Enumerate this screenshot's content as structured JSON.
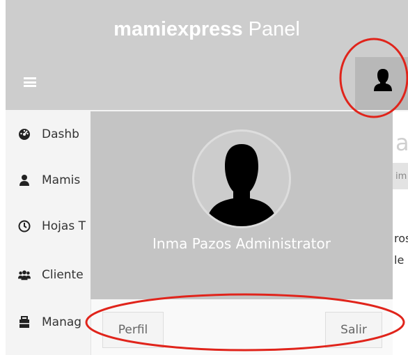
{
  "header": {
    "brand_bold": "mamiexpress",
    "brand_light": " Panel",
    "menu_icon": "hamburger-icon",
    "user_icon": "user-icon"
  },
  "sidebar": {
    "items": [
      {
        "label": "Dashb",
        "icon": "dashboard-icon"
      },
      {
        "label": "Mamis",
        "icon": "user-icon"
      },
      {
        "label": "Hojas T",
        "icon": "clock-icon"
      },
      {
        "label": "Cliente",
        "icon": "users-icon"
      },
      {
        "label": "Manag",
        "icon": "briefcase-icon"
      }
    ]
  },
  "content": {
    "title_fragment": "ab",
    "subtitle_fragment": "im",
    "text_fragment_1": "ros",
    "text_fragment_2": "le"
  },
  "user_dropdown": {
    "name": "Inma Pazos Administrator",
    "profile_button": "Perfil",
    "logout_button": "Salir"
  },
  "colors": {
    "header_bg": "#cdcdcd",
    "dropdown_bg": "#c4c4c4",
    "annotation_red": "#e0241b"
  }
}
